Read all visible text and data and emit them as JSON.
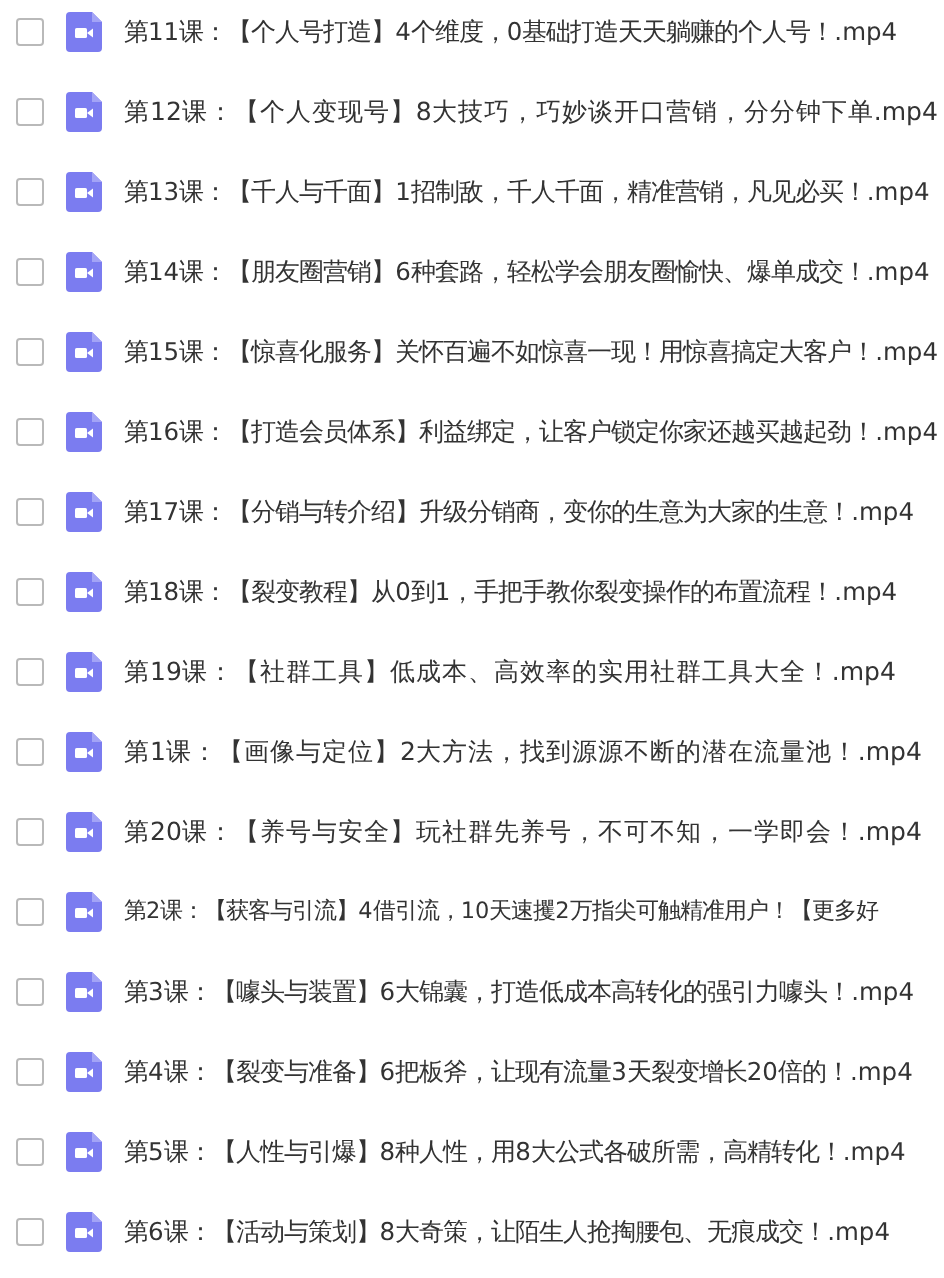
{
  "files": [
    {
      "name": "第11课：【个人号打造】4个维度，0基础打造天天躺赚的个人号！.mp4",
      "checked": false
    },
    {
      "name": "第12课：【个人变现号】8大技巧，巧妙谈开口营销，分分钟下单.mp4",
      "checked": false
    },
    {
      "name": "第13课：【千人与千面】1招制敌，千人千面，精准营销，凡见必买！.mp4",
      "checked": false
    },
    {
      "name": "第14课：【朋友圈营销】6种套路，轻松学会朋友圈愉快、爆单成交！.mp4",
      "checked": false
    },
    {
      "name": "第15课：【惊喜化服务】关怀百遍不如惊喜一现！用惊喜搞定大客户！.mp4",
      "checked": false
    },
    {
      "name": "第16课：【打造会员体系】利益绑定，让客户锁定你家还越买越起劲！.mp4",
      "checked": false
    },
    {
      "name": "第17课：【分销与转介绍】升级分销商，变你的生意为大家的生意！.mp4",
      "checked": false
    },
    {
      "name": "第18课：【裂变教程】从0到1，手把手教你裂变操作的布置流程！.mp4",
      "checked": false
    },
    {
      "name": "第19课：【社群工具】低成本、高效率的实用社群工具大全！.mp4",
      "checked": false
    },
    {
      "name": "第1课：【画像与定位】2大方法，找到源源不断的潜在流量池！.mp4",
      "checked": false
    },
    {
      "name": "第20课：【养号与安全】玩社群先养号，不可不知，一学即会！.mp4",
      "checked": false
    },
    {
      "name": "第2课：【获客与引流】4借引流，10天速攫2万指尖可触精准用户！【更多好",
      "checked": false
    },
    {
      "name": "第3课：【噱头与装置】6大锦囊，打造低成本高转化的强引力噱头！.mp4",
      "checked": false
    },
    {
      "name": "第4课：【裂变与准备】6把板斧，让现有流量3天裂变增长20倍的！.mp4",
      "checked": false
    },
    {
      "name": "第5课：【人性与引爆】8种人性，用8大公式各破所需，高精转化！.mp4",
      "checked": false
    },
    {
      "name": "第6课：【活动与策划】8大奇策，让陌生人抢掏腰包、无痕成交！.mp4",
      "checked": false
    }
  ]
}
